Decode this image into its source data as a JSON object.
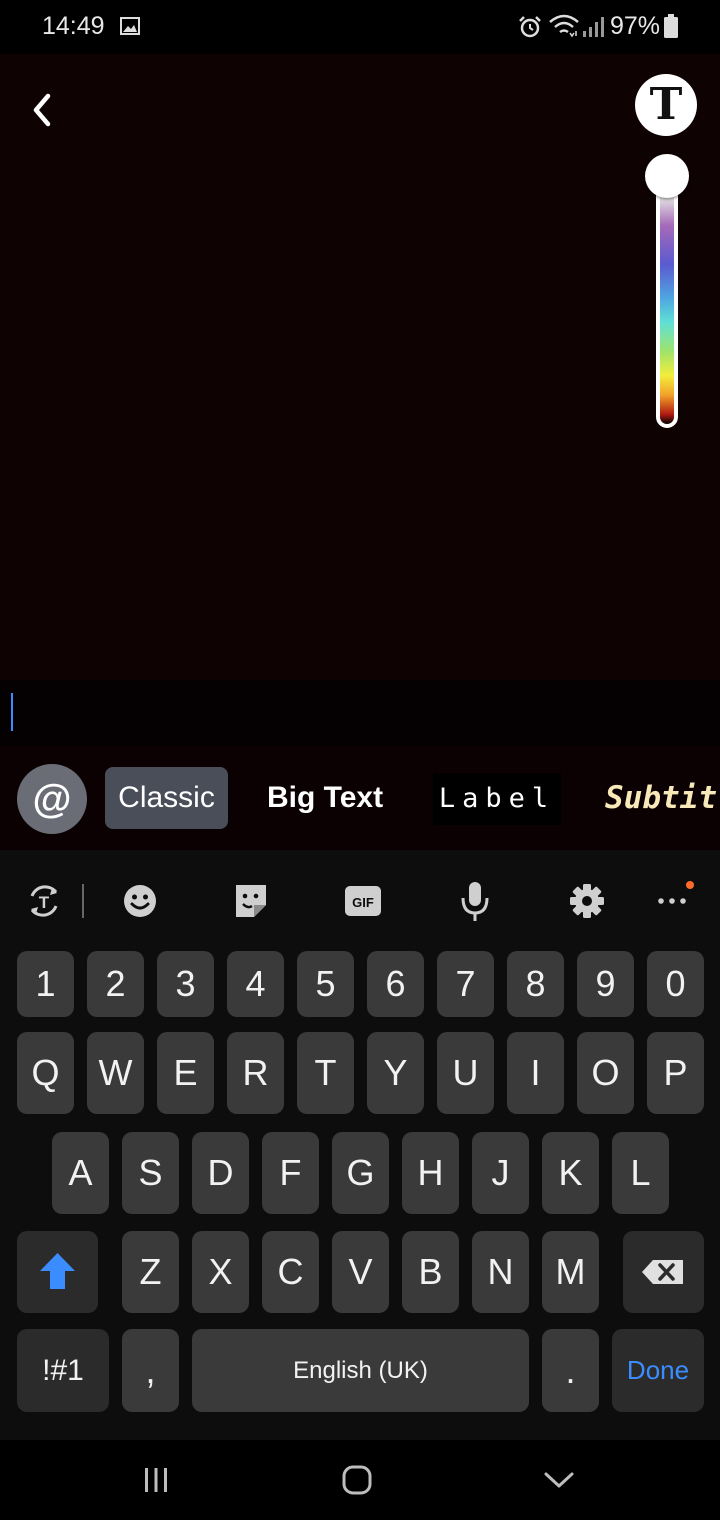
{
  "status": {
    "time": "14:49",
    "battery": "97%"
  },
  "editor": {
    "text_tool_label": "T",
    "styles": {
      "mention": "@",
      "classic": "Classic",
      "big_text": "Big Text",
      "label": "Label",
      "subtitle": "Subtitle"
    }
  },
  "keyboard": {
    "toolbar_icons": [
      "text-mode-icon",
      "emoji-icon",
      "sticker-icon",
      "gif-icon",
      "microphone-icon",
      "gear-icon",
      "more-icon"
    ],
    "gif_label": "GIF",
    "row_numbers": [
      "1",
      "2",
      "3",
      "4",
      "5",
      "6",
      "7",
      "8",
      "9",
      "0"
    ],
    "row_top": [
      "Q",
      "W",
      "E",
      "R",
      "T",
      "Y",
      "U",
      "I",
      "O",
      "P"
    ],
    "row_mid": [
      "A",
      "S",
      "D",
      "F",
      "G",
      "H",
      "J",
      "K",
      "L"
    ],
    "row_bottom": [
      "Z",
      "X",
      "C",
      "V",
      "B",
      "N",
      "M"
    ],
    "symbols_label": "!#1",
    "comma": ",",
    "space_label": "English (UK)",
    "period": ".",
    "done_label": "Done",
    "accent_color": "#3b8cff"
  }
}
